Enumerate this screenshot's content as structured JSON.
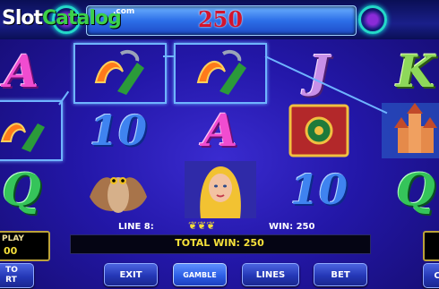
{
  "brand": {
    "name_a": "Slot",
    "name_b": "Catalog",
    "suffix": ".com"
  },
  "score": "250",
  "reels": [
    [
      "A",
      "wild-feather-symbol",
      "Q"
    ],
    [
      "wild-feather-symbol",
      "10",
      "owl-symbol"
    ],
    [
      "wild-feather-symbol",
      "A",
      "fairy-symbol"
    ],
    [
      "J",
      "book-symbol",
      "10"
    ],
    [
      "K",
      "castle-symbol",
      "Q"
    ]
  ],
  "line_info": {
    "line": "LINE 8:",
    "win": "WIN: 250",
    "total_win": "TOTAL WIN: 250"
  },
  "side": {
    "play_label": "PLAY",
    "play_value": "00",
    "to_start": "TO\nRT",
    "right_label": "C"
  },
  "buttons": {
    "exit": "EXIT",
    "gamble": "GAMBLE",
    "lines": "LINES",
    "bet": "BET"
  },
  "colors": {
    "accent": "#2317a8",
    "score": "#d2142d",
    "total_win": "#f6e13a"
  }
}
